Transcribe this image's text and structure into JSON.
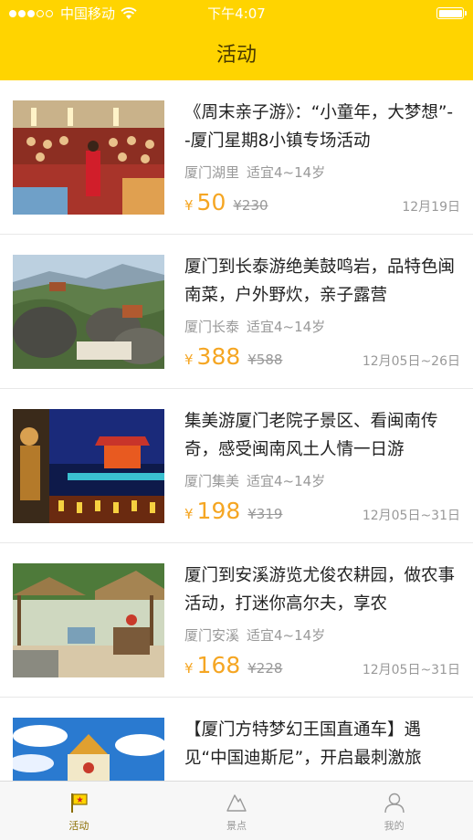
{
  "status_bar": {
    "carrier": "中国移动",
    "time": "下午4:07"
  },
  "nav": {
    "title": "活动"
  },
  "items": [
    {
      "title": "《周末亲子游》：“小童年，大梦想”--厦门星期8小镇专场活动",
      "location": "厦门湖里",
      "age": "适宜4~14岁",
      "currency": "¥",
      "price": "50",
      "original_price": "¥230",
      "date": "12月19日"
    },
    {
      "title": "厦门到长泰游绝美鼓鸣岩，品特色闽南菜，户外野炊，亲子露营",
      "location": "厦门长泰",
      "age": "适宜4~14岁",
      "currency": "¥",
      "price": "388",
      "original_price": "¥588",
      "date": "12月05日~26日"
    },
    {
      "title": "集美游厦门老院子景区、看闽南传奇，感受闽南风土人情一日游",
      "location": "厦门集美",
      "age": "适宜4~14岁",
      "currency": "¥",
      "price": "198",
      "original_price": "¥319",
      "date": "12月05日~31日"
    },
    {
      "title": "厦门到安溪游览尤俊农耕园，做农事活动，打迷你高尔夫，享农",
      "location": "厦门安溪",
      "age": "适宜4~14岁",
      "currency": "¥",
      "price": "168",
      "original_price": "¥228",
      "date": "12月05日~31日"
    },
    {
      "title": "【厦门方特梦幻王国直通车】遇见“中国迪斯尼”，开启最刺激旅"
    }
  ],
  "tabs": [
    {
      "label": "活动",
      "icon": "flag-icon",
      "active": true
    },
    {
      "label": "景点",
      "icon": "mountain-icon",
      "active": false
    },
    {
      "label": "我的",
      "icon": "person-icon",
      "active": false
    }
  ],
  "colors": {
    "header": "#FFD400",
    "price": "#F5A623",
    "active_tab": "#8a6d00"
  }
}
